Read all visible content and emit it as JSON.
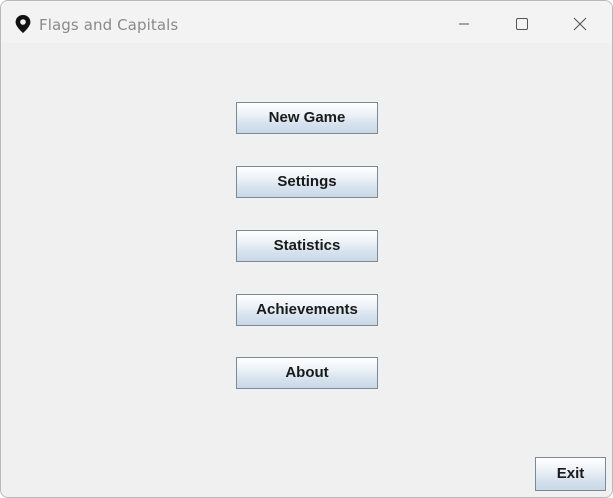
{
  "window": {
    "title": "Flags and Capitals",
    "app_icon": "map-pin-icon",
    "controls": {
      "minimize_icon": "minimize-icon",
      "maximize_icon": "maximize-icon",
      "close_icon": "close-icon"
    }
  },
  "menu": {
    "items": [
      {
        "label": "New Game"
      },
      {
        "label": "Settings"
      },
      {
        "label": "Statistics"
      },
      {
        "label": "Achievements"
      },
      {
        "label": "About"
      }
    ]
  },
  "footer": {
    "exit_label": "Exit"
  },
  "colors": {
    "window_bg": "#f0f0f0",
    "title_text": "#8a8a8a",
    "button_border": "#7a8a99",
    "button_text": "#1a1a1a"
  }
}
